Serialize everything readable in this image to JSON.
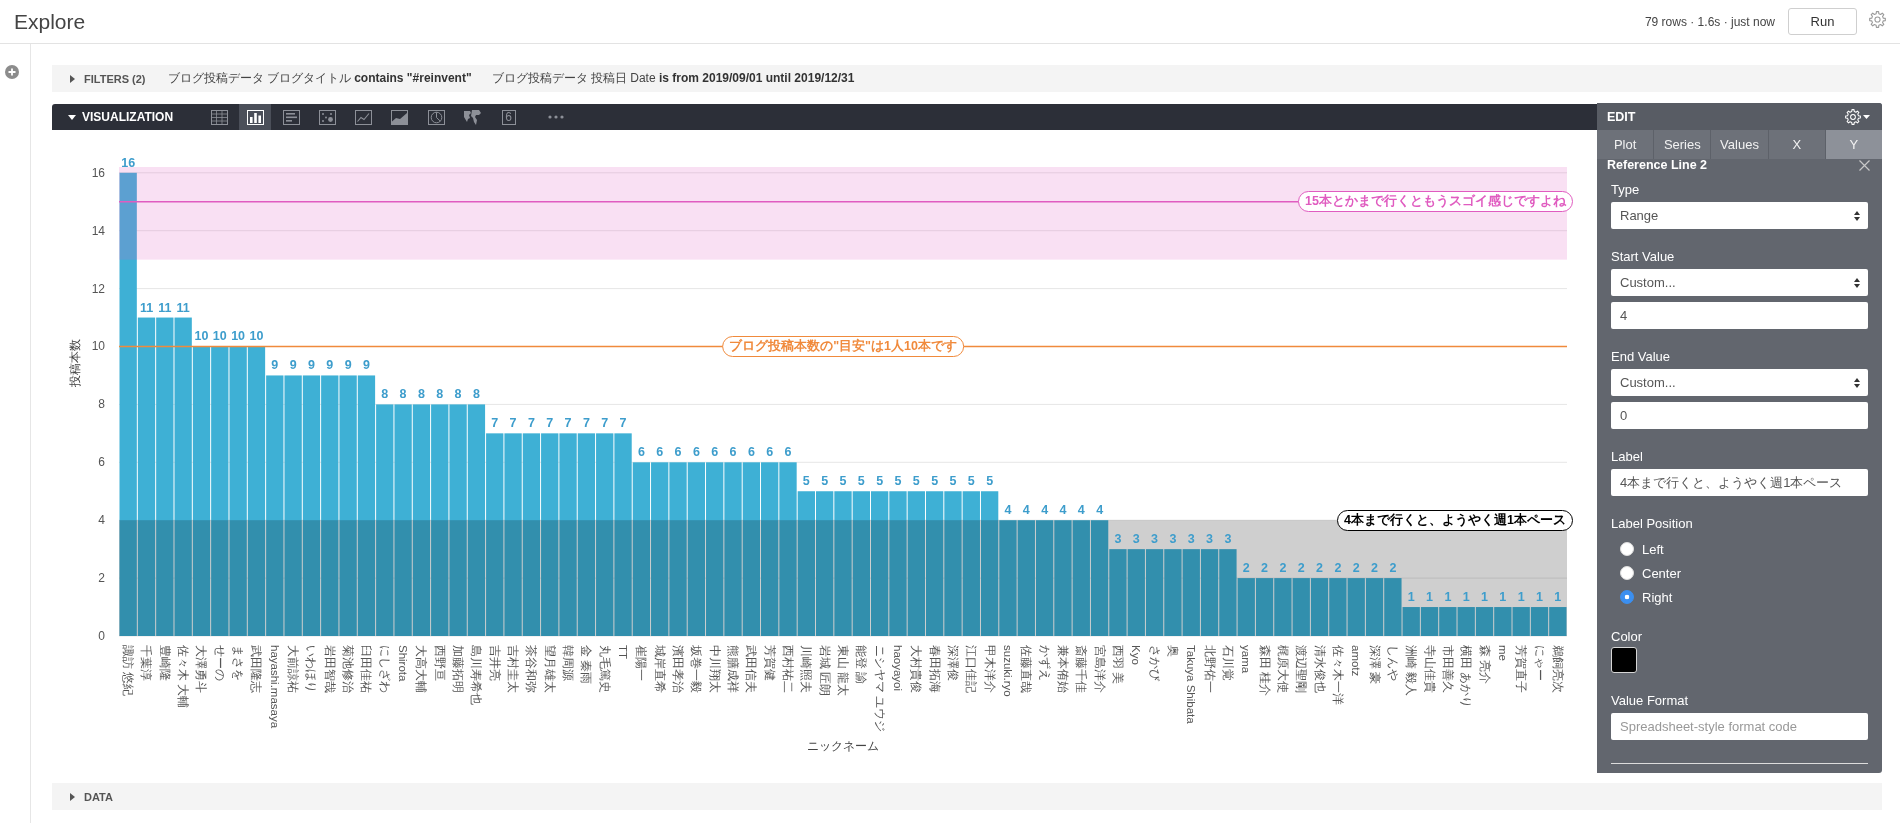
{
  "header": {
    "title": "Explore",
    "status": "79 rows · 1.6s · just now",
    "run_button": "Run"
  },
  "filters": {
    "label": "FILTERS (2)",
    "expanded": false,
    "items": [
      "ブログ投稿データ ブログタイトル **contains \"#reinvent\"**",
      "ブログ投稿データ 投稿日 Date **is from 2019/09/01 until 2019/12/31**"
    ]
  },
  "visualization": {
    "label": "VISUALIZATION",
    "expanded": true,
    "types": [
      {
        "kind": "table",
        "selected": false
      },
      {
        "kind": "column",
        "selected": true
      },
      {
        "kind": "bar",
        "selected": false
      },
      {
        "kind": "scatter",
        "selected": false
      },
      {
        "kind": "line",
        "selected": false
      },
      {
        "kind": "area",
        "selected": false
      },
      {
        "kind": "pie",
        "selected": false
      },
      {
        "kind": "map",
        "selected": false
      },
      {
        "kind": "single_value",
        "glyph": "6",
        "selected": false
      },
      {
        "kind": "more",
        "selected": false
      }
    ],
    "chart_data": {
      "type": "bar",
      "xlabel": "ニックネーム",
      "ylabel": "投稿本数",
      "categories": [
        "諏訪 悠紀",
        "千葉淳",
        "豊崎隆",
        "佐々木 大輔",
        "大澤勇斗",
        "せーの",
        "まさを",
        "武田隆志",
        "hayashi.masaya",
        "大前諒祐",
        "いわほり",
        "岩田智哉",
        "菊池修治",
        "臼田佳祐",
        "にしざわ",
        "Shirota",
        "大高大輔",
        "西野亘",
        "加藤拓明",
        "島川寿希也",
        "吉井亮",
        "吉村圭太",
        "茶谷和弥",
        "望月雄太",
        "韓周源",
        "金 秦雨",
        "丸毛篤史",
        "TT",
        "崔陽一",
        "城岸直希",
        "濱田孝治",
        "坂巻一毅",
        "中川翔太",
        "熊膳成祥",
        "武田信夫",
        "芳賀健",
        "西村祐二",
        "川崎照夫",
        "岩城 匠朗",
        "東山 龍太",
        "能登 諭",
        "ニシヤマ ユウジ",
        "haoyayoi",
        "大村貴俊",
        "春田拓海",
        "深澤俊",
        "江口佳記",
        "甲木洋介",
        "suzuki.ryo",
        "佐藤直哉",
        "かずえ",
        "兼本侑始",
        "斎藤千佳",
        "宮島洋介",
        "西羽 美",
        "Kyo",
        "さかび",
        "奥",
        "Takuya Shibata",
        "北野佑一",
        "石川覚",
        "yama",
        "森田 桂介",
        "梶原大使",
        "渡辺聖剛",
        "清水俊也",
        "佐々木一洋",
        "amotz",
        "深澤 豪",
        "しんや",
        "洲崎 毅人",
        "寺山佳貴",
        "市田善久",
        "横田 あかり",
        "森 亮介",
        "me",
        "芳賀直子",
        "にゃー",
        "鵜飼亮次"
      ],
      "values": [
        16,
        11,
        11,
        11,
        10,
        10,
        10,
        10,
        9,
        9,
        9,
        9,
        9,
        9,
        8,
        8,
        8,
        8,
        8,
        8,
        7,
        7,
        7,
        7,
        7,
        7,
        7,
        7,
        6,
        6,
        6,
        6,
        6,
        6,
        6,
        6,
        6,
        5,
        5,
        5,
        5,
        5,
        5,
        5,
        5,
        5,
        5,
        5,
        4,
        4,
        4,
        4,
        4,
        4,
        3,
        3,
        3,
        3,
        3,
        3,
        3,
        2,
        2,
        2,
        2,
        2,
        2,
        2,
        2,
        2,
        1,
        1,
        1,
        1,
        1,
        1,
        1,
        1,
        1
      ],
      "ylim": [
        0,
        16.2
      ],
      "yticks": [
        0,
        2,
        4,
        6,
        8,
        10,
        12,
        14,
        16
      ],
      "grid": true,
      "data_labels": true,
      "ref_lines": [
        {
          "axis": "y",
          "value": 15,
          "label": "15本とかまで行くともうスゴイ感じですよね",
          "color": "#e05cc0"
        },
        {
          "axis": "y",
          "value": 10,
          "label": "ブログ投稿本数の\"目安\"は1人10本です",
          "color": "#f08a3c"
        }
      ],
      "bands": [
        {
          "axis": "y",
          "from": 13,
          "to": 16.2,
          "color": "#e05cc0"
        },
        {
          "axis": "y",
          "from": 0,
          "to": 4,
          "label": "4本まで行くと、ようやく週1本ペース",
          "color": "#000000"
        }
      ]
    }
  },
  "edit_panel": {
    "title": "EDIT",
    "tabs": [
      {
        "label": "Plot",
        "selected": false
      },
      {
        "label": "Series",
        "selected": false
      },
      {
        "label": "Values",
        "selected": false
      },
      {
        "label": "X",
        "selected": false
      },
      {
        "label": "Y",
        "selected": true
      }
    ],
    "section_title": "Reference Line 2",
    "fields": [
      {
        "label": "Type",
        "controls": [
          {
            "kind": "select",
            "value": "Range"
          }
        ]
      },
      {
        "label": "Start Value",
        "controls": [
          {
            "kind": "select",
            "value": "Custom..."
          },
          {
            "kind": "input",
            "value": "4"
          }
        ]
      },
      {
        "label": "End Value",
        "controls": [
          {
            "kind": "select",
            "value": "Custom..."
          },
          {
            "kind": "input",
            "value": "0"
          }
        ]
      },
      {
        "label": "Label",
        "controls": [
          {
            "kind": "input",
            "value": "4本まで行くと、ようやく週1本ペース"
          }
        ]
      },
      {
        "label": "Label Position",
        "controls": [
          {
            "kind": "radio",
            "label": "Left",
            "selected": false
          },
          {
            "kind": "radio",
            "label": "Center",
            "selected": false
          },
          {
            "kind": "radio",
            "label": "Right",
            "selected": true
          }
        ]
      },
      {
        "label": "Color",
        "controls": [
          {
            "kind": "swatch",
            "color": "#000000"
          }
        ]
      },
      {
        "label": "Value Format",
        "controls": [
          {
            "kind": "input",
            "placeholder": "Spreadsheet-style format code"
          }
        ]
      }
    ]
  },
  "data_section": {
    "label": "DATA",
    "expanded": false
  }
}
